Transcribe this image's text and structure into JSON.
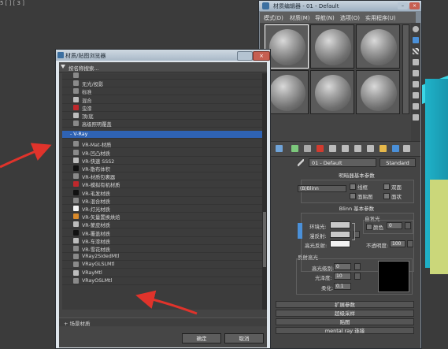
{
  "viewport": {
    "label": "5 [ ] [ 3 ]",
    "accent_cyan": "#1fb2c9",
    "arrow_color": "#e0332b"
  },
  "material_editor": {
    "title": "材质编辑器 - 01 - Default",
    "menus": [
      "模式(D)",
      "材质(M)",
      "导航(N)",
      "选项(O)",
      "实用程序(U)"
    ],
    "material_name": "01 - Default",
    "material_type": "Standard",
    "shader_rollout": "明暗器基本参数",
    "shader_type": "(B)Blinn",
    "shader_options": [
      "线框",
      "双面",
      "面贴图",
      "面状"
    ],
    "blinn_rollout": "Blinn 基本参数",
    "self_illum_group": "自发光",
    "self_illum_color_label": "颜色",
    "self_illum_value": "0",
    "ambient_label": "环境光:",
    "diffuse_label": "漫反射:",
    "specular_label": "高光反射:",
    "opacity_label": "不透明度:",
    "opacity_value": "100",
    "specular_highlights": "反射高光",
    "specular_level_label": "高光级别:",
    "specular_level_value": "0",
    "glossiness_label": "光泽度:",
    "glossiness_value": "10",
    "soften_label": "柔化:",
    "soften_value": "0.1",
    "rollouts": [
      "扩展参数",
      "超级采样",
      "贴图",
      "mental ray 连接"
    ]
  },
  "browser": {
    "title": "材质/贴图浏览器",
    "close_label": "×",
    "search_placeholder": "按名称搜索...",
    "items_above": [
      {
        "label": "",
        "color": "#8a8a8a"
      },
      {
        "label": "无光/投影",
        "color": "#8a8a8a"
      },
      {
        "label": "标准",
        "color": "#8a8a8a"
      },
      {
        "label": "混合",
        "color": "#bdbdbd"
      },
      {
        "label": "虫漆",
        "color": "#c0282c"
      },
      {
        "label": "顶/底",
        "color": "#bdbdbd"
      },
      {
        "label": "高级照明覆盖",
        "color": "#8a8a8a"
      }
    ],
    "group_label": "- V-Ray",
    "vray_items": [
      {
        "label": "VR-Mat-材质",
        "color": "#8a8a8a"
      },
      {
        "label": "VR-凹凸材质",
        "color": "#8a8a8a"
      },
      {
        "label": "VR-快速 SSS2",
        "color": "#bdbdbd"
      },
      {
        "label": "VR-散布体积",
        "color": "#111111"
      },
      {
        "label": "VR-材质包裹器",
        "color": "#8a8a8a"
      },
      {
        "label": "VR-模拟有机材质",
        "color": "#c0282c"
      },
      {
        "label": "VR-毛发材质",
        "color": "#111111"
      },
      {
        "label": "VR-混合材质",
        "color": "#8a8a8a"
      },
      {
        "label": "VR-灯光材质",
        "color": "#f2f2f2"
      },
      {
        "label": "VR-矢量置换烘焙",
        "color": "#d98a2b"
      },
      {
        "label": "VR-蒙皮材质",
        "color": "#bdbdbd"
      },
      {
        "label": "VR-覆盖材质",
        "color": "#111111"
      },
      {
        "label": "VR-车漆材质",
        "color": "#bdbdbd"
      },
      {
        "label": "VR-雪花材质",
        "color": "#8a8a8a"
      },
      {
        "label": "VRay2SidedMtl",
        "color": "#8a8a8a"
      },
      {
        "label": "VRayGLSLMtl",
        "color": "#8a8a8a"
      },
      {
        "label": "VRayMtl",
        "color": "#bdbdbd"
      },
      {
        "label": "VRayOSLMtl",
        "color": "#8a8a8a"
      }
    ],
    "scene_materials": "+ 场景材质",
    "ok_label": "确定",
    "cancel_label": "取消"
  }
}
